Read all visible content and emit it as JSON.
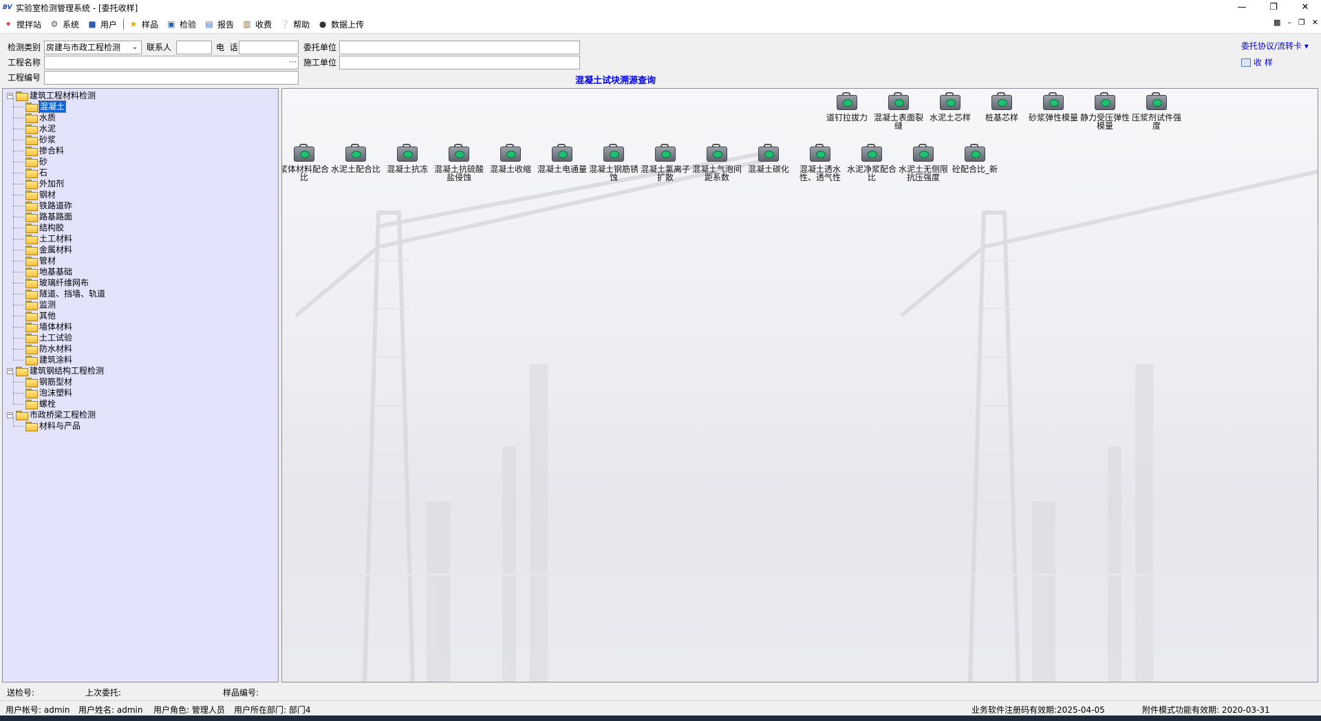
{
  "window": {
    "title": "实验室检测管理系统 - [委托收样]",
    "app_icon": "app-logo",
    "controls": [
      "minimize",
      "restore",
      "close"
    ]
  },
  "menubar": {
    "items": [
      {
        "label": "搅拌站",
        "icon": "mixer-icon"
      },
      {
        "label": "系统",
        "icon": "tools-icon"
      },
      {
        "label": "用户",
        "icon": "user-icon"
      },
      {
        "label": "样品",
        "icon": "star-icon"
      },
      {
        "label": "检验",
        "icon": "monitor-icon"
      },
      {
        "label": "报告",
        "icon": "report-icon"
      },
      {
        "label": "收费",
        "icon": "clipboard-icon"
      },
      {
        "label": "帮助",
        "icon": "help-icon"
      },
      {
        "label": "数据上传",
        "icon": "database-icon"
      }
    ]
  },
  "form": {
    "type_label": "检测类别",
    "type_value": "房建与市政工程检测",
    "contact_label": "联系人",
    "contact_value": "",
    "phone_label": "电  话",
    "phone_value": "",
    "client_label": "委托单位",
    "client_value": "",
    "project_name_label": "工程名称",
    "project_name_value": "",
    "builder_label": "施工单位",
    "builder_value": "",
    "project_no_label": "工程编号",
    "project_no_value": "",
    "trace_query_link": "混凝土试块溯源查询",
    "protocol_link": "委托协议/流转卡",
    "receive_button": "收 样"
  },
  "tree": {
    "groups": [
      {
        "label": "建筑工程材料检测",
        "children": [
          "混凝土",
          "水质",
          "水泥",
          "砂浆",
          "掺合料",
          "砂",
          "石",
          "外加剂",
          "钢材",
          "铁路道砟",
          "路基路面",
          "结构胶",
          "土工材料",
          "金属材料",
          "管材",
          "地基基础",
          "玻璃纤维网布",
          "隧道、挡墙、轨道",
          "监测",
          "其他",
          "墙体材料",
          "土工试验",
          "防水材料",
          "建筑涂料"
        ]
      },
      {
        "label": "建筑钢结构工程检测",
        "children": [
          "钢筋型材",
          "泡沫塑料",
          "螺栓"
        ]
      },
      {
        "label": "市政桥梁工程检测",
        "children": [
          "材料与产品"
        ]
      }
    ],
    "selected": "混凝土"
  },
  "icons_row1": [
    "道钉拉拔力",
    "混凝土表面裂缝",
    "水泥土芯样",
    "桩基芯样",
    "砂浆弹性模量",
    "静力受压弹性模量",
    "压浆剂试件强度"
  ],
  "icons_row2": [
    "浆体材料配合比",
    "水泥土配合比",
    "混凝土抗冻",
    "混凝土抗硫酸盐侵蚀",
    "混凝土收缩",
    "混凝土电通量",
    "混凝土钢筋锈蚀",
    "混凝土氯离子扩散",
    "混凝土气泡间距系数",
    "混凝土碳化",
    "混凝土透水性、透气性",
    "水泥净浆配合比",
    "水泥土无侧限抗压强度",
    "砼配合比_新"
  ],
  "status": {
    "send_no": "送检号:",
    "last_client": "上次委托:",
    "sample_no": "样品编号:",
    "account": "用户帐号: admin",
    "username": "用户姓名: admin",
    "role": "用户角色: 管理人员",
    "dept": "用户所在部门: 部门4",
    "license_expiry": "业务软件注册码有效期:2025-04-05",
    "attachment_expiry": "附件模式功能有效期: 2020-03-31"
  },
  "colors": {
    "tree_bg": "#e3e4fb",
    "link": "#0000ee",
    "selection": "#0a64d8"
  }
}
